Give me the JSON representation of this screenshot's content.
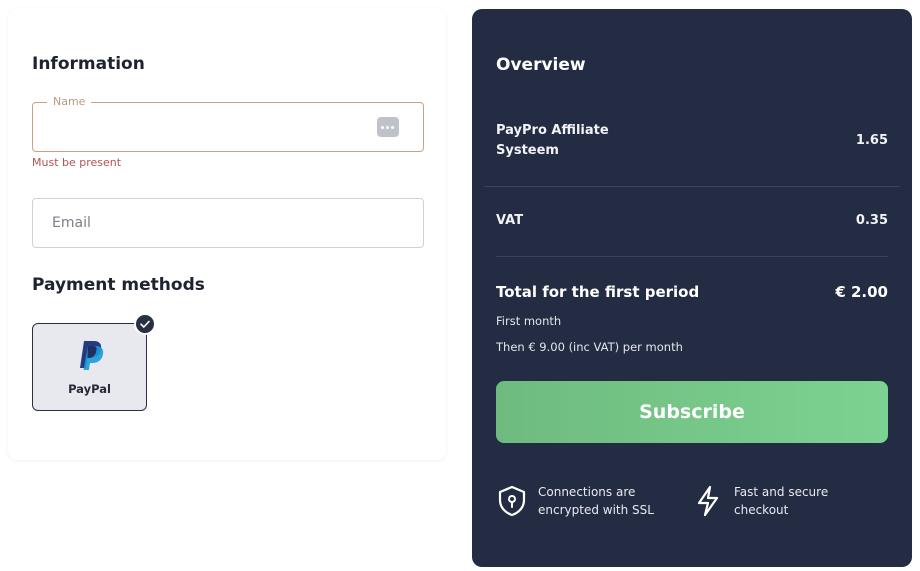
{
  "information": {
    "title": "Information",
    "name_field": {
      "label": "Name",
      "value": "",
      "error": "Must be present"
    },
    "email_field": {
      "placeholder": "Email",
      "value": ""
    }
  },
  "payment_methods": {
    "title": "Payment methods",
    "options": [
      {
        "label": "PayPal",
        "icon": "paypal-logo",
        "selected": true
      }
    ]
  },
  "overview": {
    "title": "Overview",
    "product": {
      "label": "PayPro Affiliate Systeem",
      "value": "1.65"
    },
    "vat": {
      "label": "VAT",
      "value": "0.35"
    },
    "total": {
      "label": "Total for the first period",
      "value": "€ 2.00"
    },
    "first_month": "First month",
    "then_text": "Then € 9.00 (inc VAT) per month",
    "subscribe_label": "Subscribe",
    "features": [
      {
        "icon": "shield-lock-icon",
        "text": "Connections are encrypted with SSL"
      },
      {
        "icon": "lightning-icon",
        "text": "Fast and secure checkout"
      }
    ]
  },
  "colors": {
    "panel_bg": "#232c42",
    "accent_green": "#74c688",
    "error": "#b05252",
    "name_border": "#c8a383"
  }
}
